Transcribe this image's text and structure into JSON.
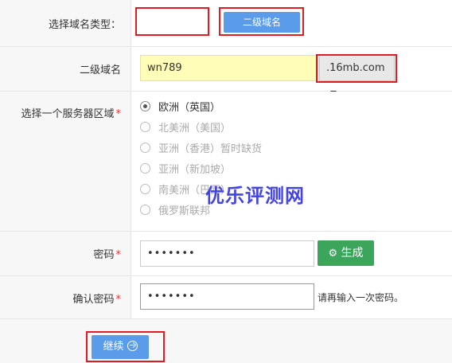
{
  "domain_type_row": {
    "label": "选择域名类型：",
    "type_input_value": "",
    "second_level_button": "二级域名"
  },
  "subdomain_row": {
    "label": "二级域名",
    "value": "wn789",
    "suffix_select": ".16mb.com"
  },
  "server_region_row": {
    "label": "选择一个服务器区域",
    "required_mark": "*",
    "options": [
      {
        "label": "欧洲（英国）",
        "selected": true,
        "disabled": false
      },
      {
        "label": "北美洲（美国）",
        "selected": false,
        "disabled": true
      },
      {
        "label": "亚洲（香港）暂时缺货",
        "selected": false,
        "disabled": true
      },
      {
        "label": "亚洲（新加坡）",
        "selected": false,
        "disabled": true
      },
      {
        "label": "南美洲（巴西）",
        "selected": false,
        "disabled": true
      },
      {
        "label": "俄罗斯联邦",
        "selected": false,
        "disabled": true
      }
    ]
  },
  "password_row": {
    "label": "密码",
    "required_mark": "*",
    "value": "•••••••",
    "generate_button": "生成"
  },
  "confirm_row": {
    "label": "确认密码",
    "required_mark": "*",
    "value": "•••••••",
    "hint": "请再输入一次密码。"
  },
  "footer": {
    "continue_button": "继续"
  },
  "watermark": "优乐评测网",
  "colors": {
    "accent_blue": "#5a9bea",
    "green": "#3ba55c",
    "highlight_red": "#e01b24",
    "watermark": "#3b3be0"
  }
}
